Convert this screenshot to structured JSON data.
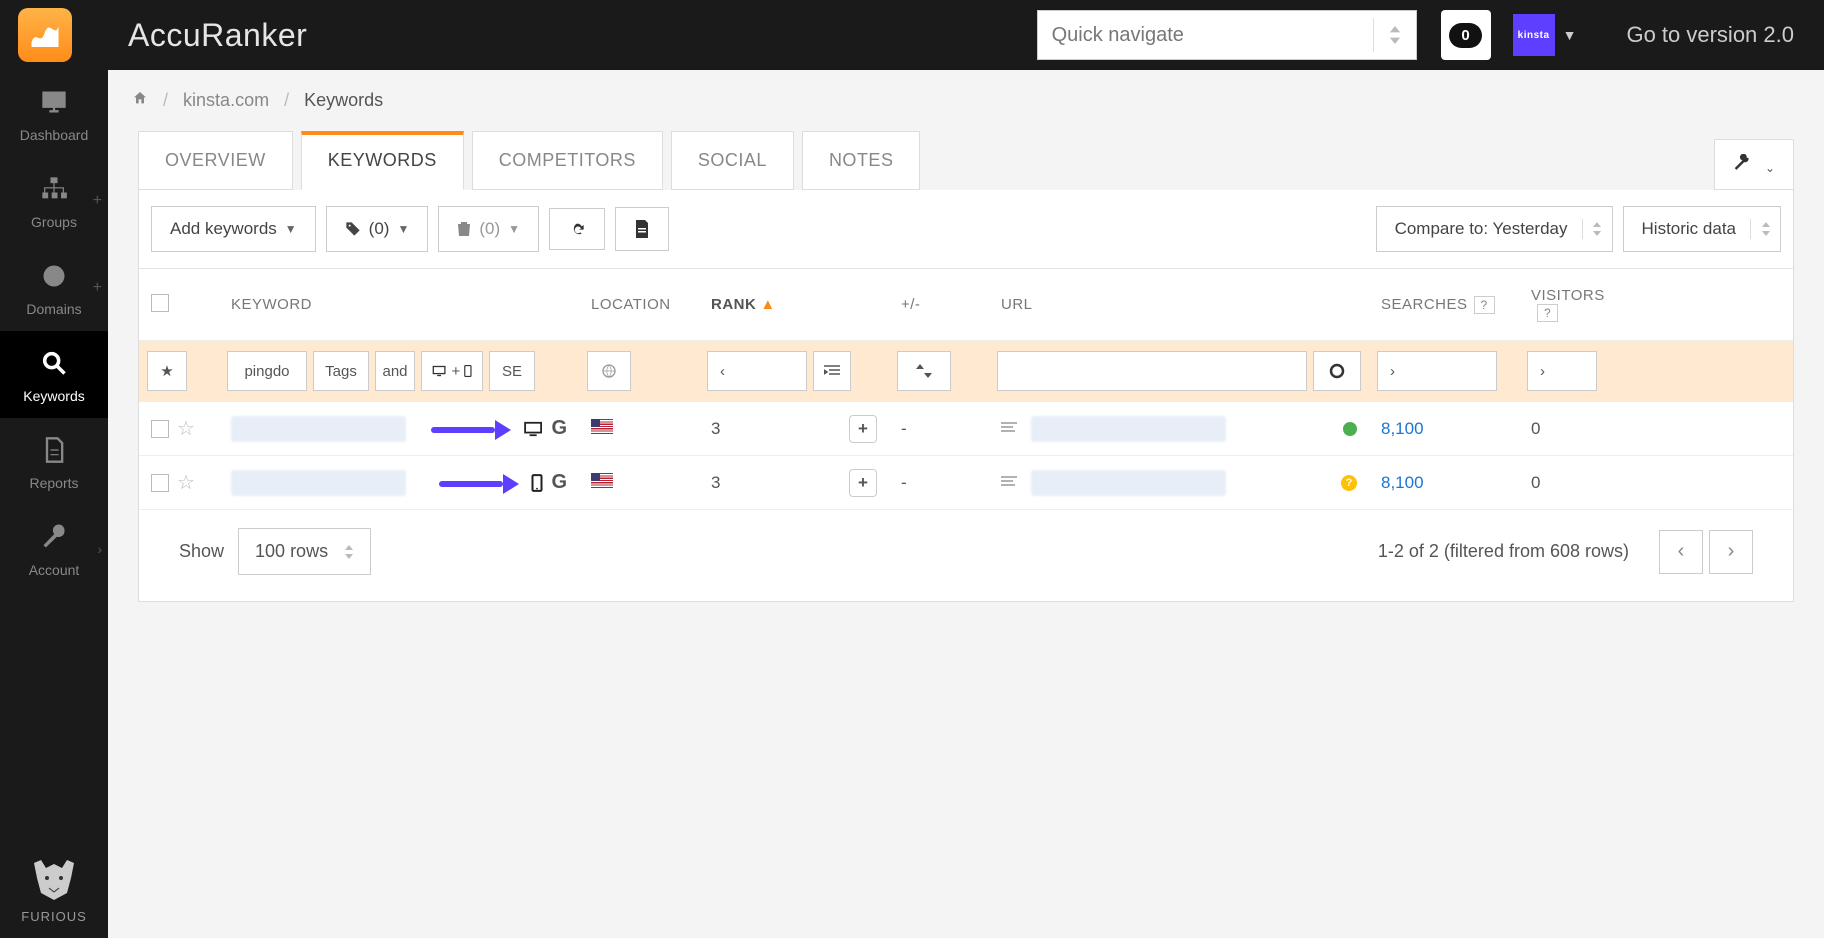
{
  "brand": "AccuRanker",
  "topbar": {
    "quick_nav_placeholder": "Quick navigate",
    "counter": "0",
    "account_badge": "kinsta",
    "version_link": "Go to version 2.0"
  },
  "sidebar": {
    "items": [
      {
        "label": "Dashboard"
      },
      {
        "label": "Groups"
      },
      {
        "label": "Domains"
      },
      {
        "label": "Keywords"
      },
      {
        "label": "Reports"
      },
      {
        "label": "Account"
      }
    ],
    "furious": "FURIOUS"
  },
  "breadcrumb": {
    "domain": "kinsta.com",
    "current": "Keywords"
  },
  "tabs": {
    "overview": "OVERVIEW",
    "keywords": "KEYWORDS",
    "competitors": "COMPETITORS",
    "social": "SOCIAL",
    "notes": "NOTES"
  },
  "toolbar": {
    "add_keywords": "Add keywords",
    "tag_count": "(0)",
    "trash_count": "(0)",
    "compare_to": "Compare to: Yesterday",
    "historic": "Historic data"
  },
  "table": {
    "headers": {
      "keyword": "KEYWORD",
      "location": "LOCATION",
      "rank": "RANK",
      "change": "+/-",
      "url": "URL",
      "searches": "SEARCHES",
      "visitors": "VISITORS",
      "help": "?"
    },
    "filters": {
      "keyword_input": "pingdo",
      "tags": "Tags",
      "and": "and",
      "se": "SE"
    },
    "rows": [
      {
        "rank": "3",
        "change": "-",
        "status": "green",
        "searches": "8,100",
        "visitors": "0",
        "device": "desktop"
      },
      {
        "rank": "3",
        "change": "-",
        "status": "yellow",
        "searches": "8,100",
        "visitors": "0",
        "device": "mobile"
      }
    ]
  },
  "footer": {
    "show": "Show",
    "rows_select": "100 rows",
    "status": "1-2 of 2 (filtered from 608 rows)"
  }
}
